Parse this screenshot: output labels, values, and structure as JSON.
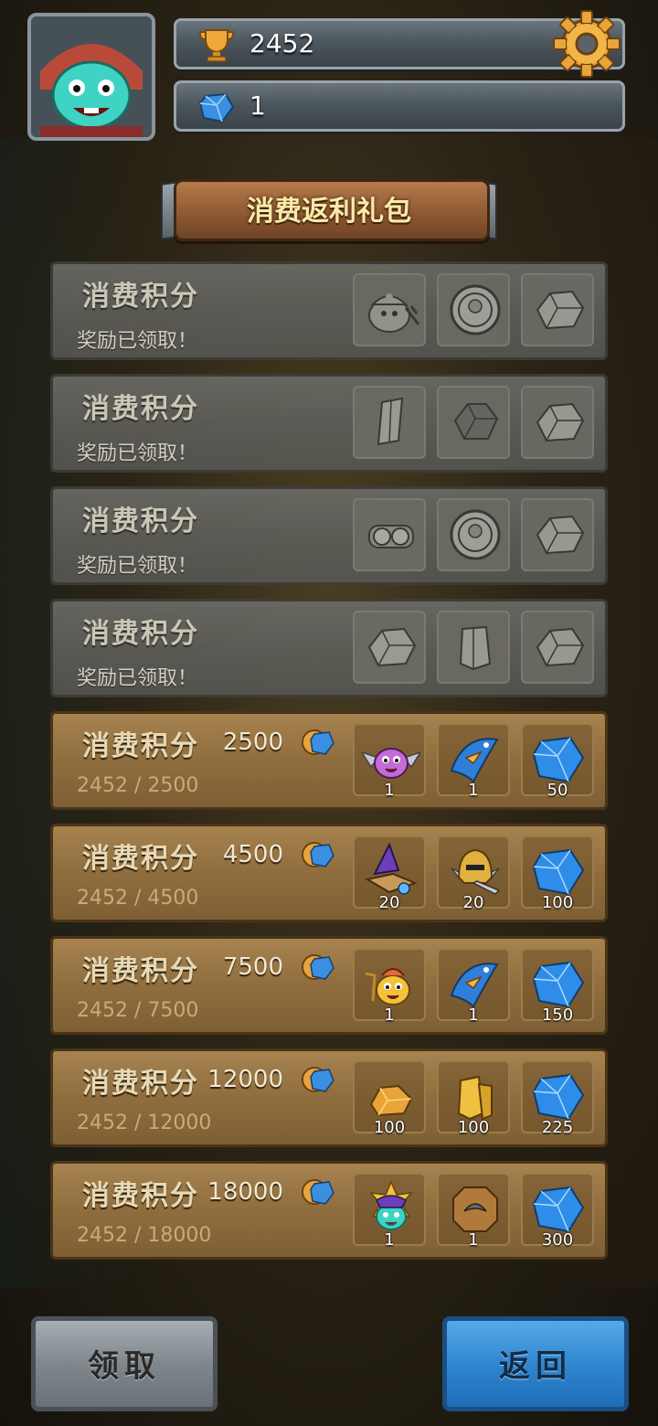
{
  "header": {
    "trophies": "2452",
    "gems": "1"
  },
  "banner": {
    "title": "消费返利礼包"
  },
  "tiers": [
    {
      "label": "消费积分",
      "status": "奖励已领取！",
      "claimed": true,
      "rewards": [
        {
          "icon": "miner-blob-icon"
        },
        {
          "icon": "silver-coin-icon"
        },
        {
          "icon": "ore-chunk-icon"
        }
      ]
    },
    {
      "label": "消费积分",
      "status": "奖励已领取！",
      "claimed": true,
      "rewards": [
        {
          "icon": "crystal-shard-icon"
        },
        {
          "icon": "dark-stone-icon"
        },
        {
          "icon": "ore-chunk-icon"
        }
      ]
    },
    {
      "label": "消费积分",
      "status": "奖励已领取！",
      "claimed": true,
      "rewards": [
        {
          "icon": "goggles-icon"
        },
        {
          "icon": "silver-coin-icon"
        },
        {
          "icon": "ore-chunk-icon"
        }
      ]
    },
    {
      "label": "消费积分",
      "status": "奖励已领取！",
      "claimed": true,
      "rewards": [
        {
          "icon": "ore-chunk-icon"
        },
        {
          "icon": "stone-pillar-icon"
        },
        {
          "icon": "ore-chunk-icon"
        }
      ]
    },
    {
      "label": "消费积分",
      "cost": "2500",
      "progress": "2452 / 2500",
      "claimed": false,
      "rewards": [
        {
          "icon": "winged-pink-hero-icon",
          "qty": "1"
        },
        {
          "icon": "blue-fish-icon",
          "qty": "1"
        },
        {
          "icon": "blue-gem-icon",
          "qty": "50"
        }
      ]
    },
    {
      "label": "消费积分",
      "cost": "4500",
      "progress": "2452 / 4500",
      "claimed": false,
      "rewards": [
        {
          "icon": "wizard-book-icon",
          "qty": "20"
        },
        {
          "icon": "knight-helmet-icon",
          "qty": "20"
        },
        {
          "icon": "blue-gem-icon",
          "qty": "100"
        }
      ]
    },
    {
      "label": "消费积分",
      "cost": "7500",
      "progress": "2452 / 7500",
      "claimed": false,
      "rewards": [
        {
          "icon": "golden-hero-icon",
          "qty": "1"
        },
        {
          "icon": "blue-fish-icon",
          "qty": "1"
        },
        {
          "icon": "blue-gem-icon",
          "qty": "150"
        }
      ]
    },
    {
      "label": "消费积分",
      "cost": "12000",
      "progress": "2452 / 12000",
      "claimed": false,
      "rewards": [
        {
          "icon": "gold-nugget-icon",
          "qty": "100"
        },
        {
          "icon": "gold-bars-icon",
          "qty": "100"
        },
        {
          "icon": "blue-gem-icon",
          "qty": "225"
        }
      ]
    },
    {
      "label": "消费积分",
      "cost": "18000",
      "progress": "2452 / 18000",
      "claimed": false,
      "rewards": [
        {
          "icon": "star-mage-hero-icon",
          "qty": "1"
        },
        {
          "icon": "bronze-emblem-icon",
          "qty": "1"
        },
        {
          "icon": "blue-gem-icon",
          "qty": "300"
        }
      ]
    }
  ],
  "buttons": {
    "claim": "领取",
    "back": "返回"
  }
}
